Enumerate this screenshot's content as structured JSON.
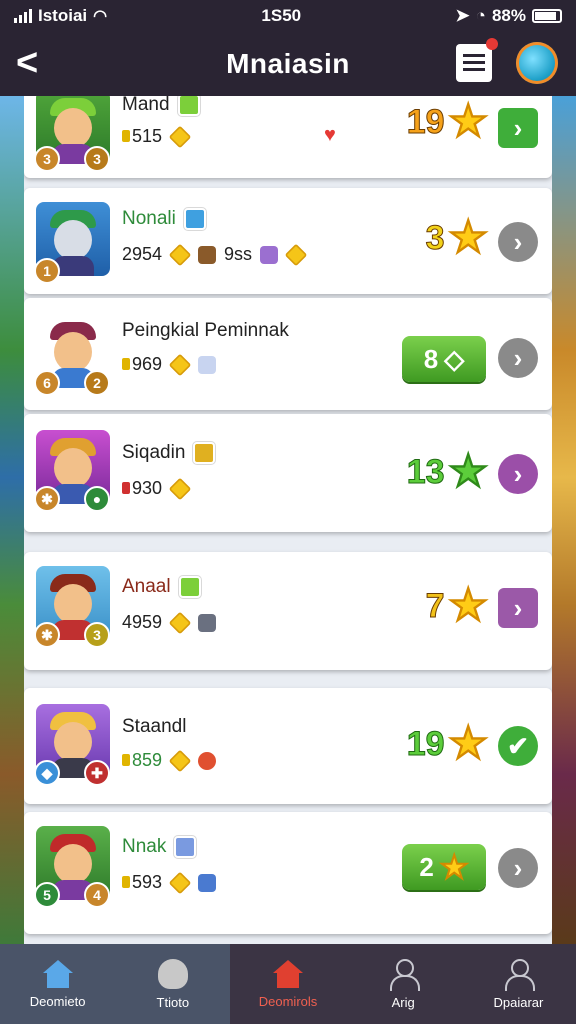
{
  "status_bar": {
    "carrier": "Istoiai",
    "time": "1S50",
    "battery": "88%"
  },
  "header": {
    "title": "Mnaiasin",
    "back_glyph": "<"
  },
  "colors": {
    "header_bg": "#2a2433",
    "nav_bg": "#3b3444",
    "green": "#4caf50",
    "gray": "#8a8a8a",
    "purple": "#9b59a8",
    "gold": "#f5c518"
  },
  "players": [
    {
      "name": "Mand",
      "stat1": "515",
      "score": "19",
      "action": "arrow",
      "icon": "arrow-right-icon"
    },
    {
      "name": "Nonali",
      "stat1": "2954",
      "stat2": "9ss",
      "score": "3",
      "action": "arrow",
      "icon": "arrow-right-icon"
    },
    {
      "name": "Peingkial Peminnak",
      "stat1": "969",
      "pill": "8",
      "action": "arrow",
      "icon": "arrow-right-icon"
    },
    {
      "name": "Siqadin",
      "stat1": "930",
      "score": "13",
      "action": "arrow",
      "icon": "arrow-right-icon"
    },
    {
      "name": "Anaal",
      "stat1": "4959",
      "score": "7",
      "action": "arrow",
      "icon": "arrow-right-icon"
    },
    {
      "name": "Staandl",
      "stat1": "859",
      "score": "19",
      "action": "check",
      "icon": "check-icon"
    },
    {
      "name": "Nnak",
      "stat1": "593",
      "pill": "2",
      "action": "arrow",
      "icon": "arrow-right-icon"
    }
  ],
  "badges": [
    {
      "l": "3",
      "r": "3"
    },
    {
      "l": "1",
      "r": ""
    },
    {
      "l": "6",
      "r": "2"
    },
    {
      "l": "",
      "r": ""
    },
    {
      "l": "",
      "r": "3"
    },
    {
      "l": "",
      "r": ""
    },
    {
      "l": "5",
      "r": "4"
    }
  ],
  "nav": [
    {
      "label": "Deomieto",
      "icon": "home-icon"
    },
    {
      "label": "Ttioto",
      "icon": "shield-icon"
    },
    {
      "label": "Deomirols",
      "icon": "home-icon"
    },
    {
      "label": "Arig",
      "icon": "person-icon"
    },
    {
      "label": "Dpaiarar",
      "icon": "person-icon"
    }
  ]
}
